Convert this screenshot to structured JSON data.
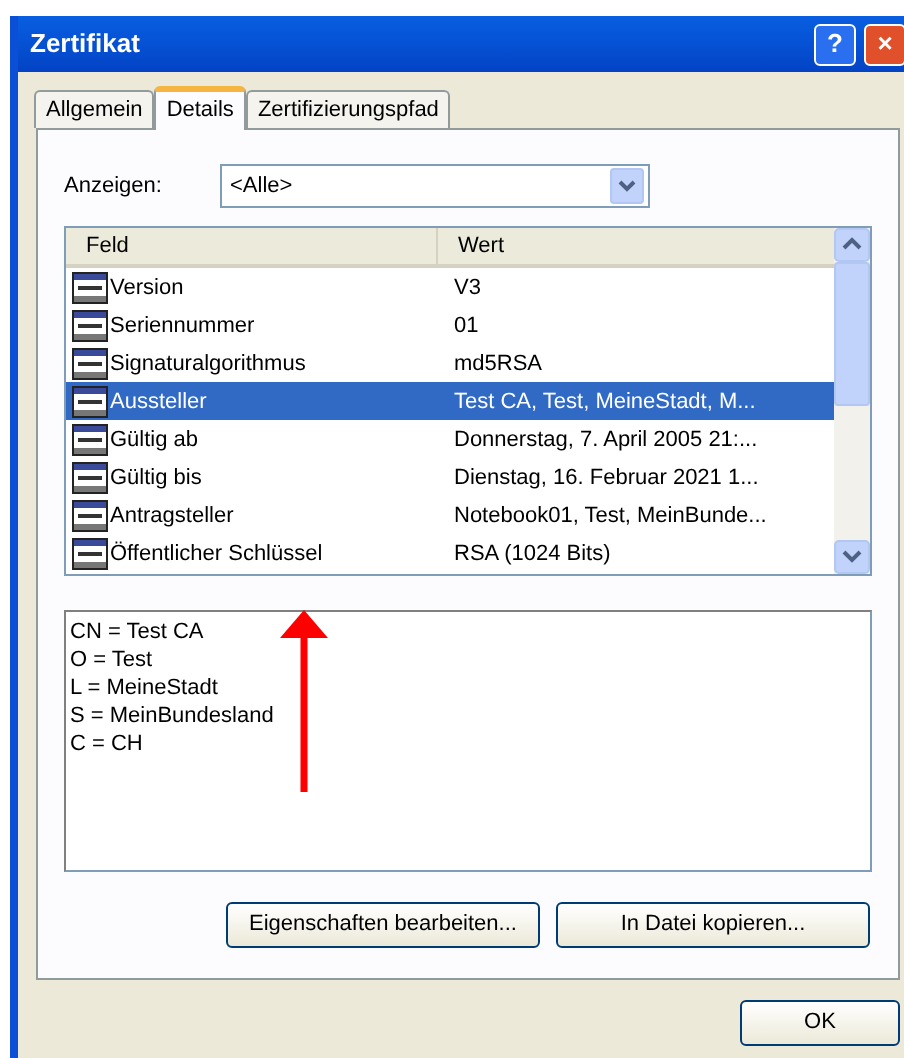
{
  "window": {
    "title": "Zertifikat"
  },
  "title_buttons": [
    {
      "kind": "help",
      "label": "?"
    },
    {
      "kind": "close",
      "label": "×"
    }
  ],
  "tabs": [
    {
      "label": "Allgemein",
      "selected": false
    },
    {
      "label": "Details",
      "selected": true
    },
    {
      "label": "Zertifizierungspfad",
      "selected": false
    }
  ],
  "show": {
    "label": "Anzeigen:",
    "value": "<Alle>"
  },
  "fields_table": {
    "columns": [
      "Feld",
      "Wert"
    ],
    "rows": [
      {
        "field": "Version",
        "value": "V3",
        "selected": false
      },
      {
        "field": "Seriennummer",
        "value": "01",
        "selected": false
      },
      {
        "field": "Signaturalgorithmus",
        "value": "md5RSA",
        "selected": false
      },
      {
        "field": "Aussteller",
        "value": "Test CA, Test, MeineStadt, M...",
        "selected": true
      },
      {
        "field": "Gültig ab",
        "value": "Donnerstag, 7. April 2005 21:...",
        "selected": false
      },
      {
        "field": "Gültig bis",
        "value": "Dienstag, 16. Februar 2021 1...",
        "selected": false
      },
      {
        "field": "Antragsteller",
        "value": "Notebook01, Test, MeinBunde...",
        "selected": false
      },
      {
        "field": "Öffentlicher Schlüssel",
        "value": "RSA (1024 Bits)",
        "selected": false
      }
    ]
  },
  "detail_lines": [
    "CN = Test CA",
    "O = Test",
    "L = MeineStadt",
    "S = MeinBundesland",
    "C = CH"
  ],
  "annotation": {
    "kind": "arrow"
  },
  "buttons": [
    "Eigenschaften bearbeiten...",
    "In Datei kopieren..."
  ],
  "footer_buttons": [
    "OK"
  ]
}
